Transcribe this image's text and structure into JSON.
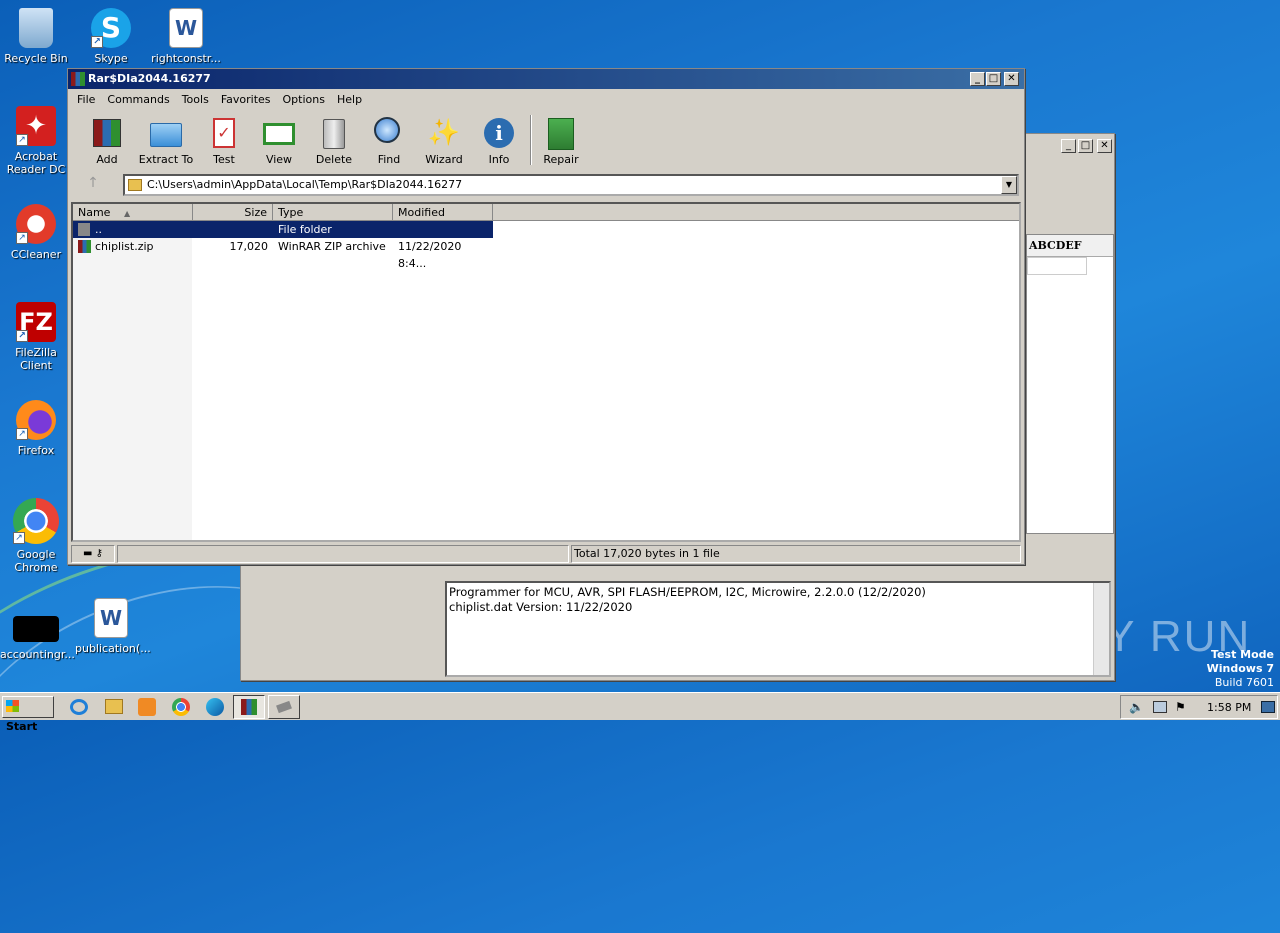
{
  "desktop": {
    "icons": [
      {
        "label": "Recycle Bin"
      },
      {
        "label": "Skype"
      },
      {
        "label": "rightconstr..."
      },
      {
        "label": "Acrobat Reader DC"
      },
      {
        "label": "CCleaner"
      },
      {
        "label": "FileZilla Client"
      },
      {
        "label": "Firefox"
      },
      {
        "label": "Google Chrome"
      },
      {
        "label": "accountingr..."
      },
      {
        "label": "publication(..."
      }
    ],
    "watermark": "ANY RUN",
    "test_mode": {
      "line1": "Test Mode",
      "line2": "Windows 7",
      "line3": "Build 7601"
    }
  },
  "back_window": {
    "heading": "ABCDEF",
    "log_lines": [
      "Programmer for MCU, AVR, SPI FLASH/EEPROM, I2C, Microwire, 2.2.0.0 (12/2/2020)",
      "chiplist.dat Version: 11/22/2020"
    ]
  },
  "winrar": {
    "title": "Rar$DIa2044.16277",
    "menu": [
      "File",
      "Commands",
      "Tools",
      "Favorites",
      "Options",
      "Help"
    ],
    "toolbar": [
      "Add",
      "Extract To",
      "Test",
      "View",
      "Delete",
      "Find",
      "Wizard",
      "Info",
      "Repair"
    ],
    "path": "C:\\Users\\admin\\AppData\\Local\\Temp\\Rar$DIa2044.16277",
    "columns": [
      "Name",
      "Size",
      "Type",
      "Modified"
    ],
    "rows": [
      {
        "name": "..",
        "size": "",
        "type": "File folder",
        "modified": ""
      },
      {
        "name": "chiplist.zip",
        "size": "17,020",
        "type": "WinRAR ZIP archive",
        "modified": "11/22/2020 8:4..."
      }
    ],
    "status": "Total 17,020 bytes in 1 file"
  },
  "taskbar": {
    "start": "Start",
    "clock": "1:58 PM"
  },
  "colors": {
    "titlebar": "#0a246a",
    "selection": "#0a246a",
    "window_bg": "#d4d0c8"
  }
}
